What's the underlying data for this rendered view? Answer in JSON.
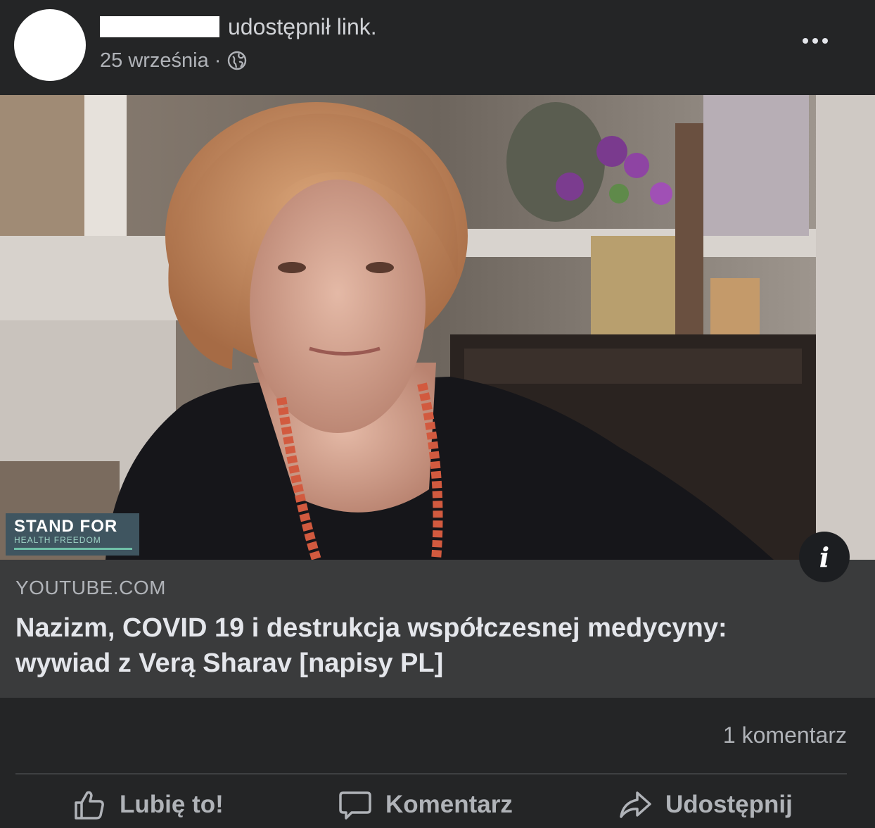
{
  "post": {
    "shared_text": "udostępnił link.",
    "date": "25 września",
    "separator": "·",
    "privacy_icon": "globe-icon",
    "menu_icon": "more-options-icon"
  },
  "media": {
    "brand_line1": "STAND FOR",
    "brand_line2": "HEALTH FREEDOM",
    "info_icon_label": "i"
  },
  "link": {
    "domain": "YOUTUBE.COM",
    "title": "Nazizm, COVID 19 i destrukcja współczesnej medycyny: wywiad z Verą Sharav [napisy PL]"
  },
  "footer": {
    "comments_count": "1 komentarz",
    "like_label": "Lubię to!",
    "comment_label": "Komentarz",
    "share_label": "Udostępnij"
  },
  "colors": {
    "background": "#242526",
    "link_box": "#3a3b3c",
    "text_primary": "#e4e6eb",
    "text_secondary": "#b0b3b8"
  }
}
